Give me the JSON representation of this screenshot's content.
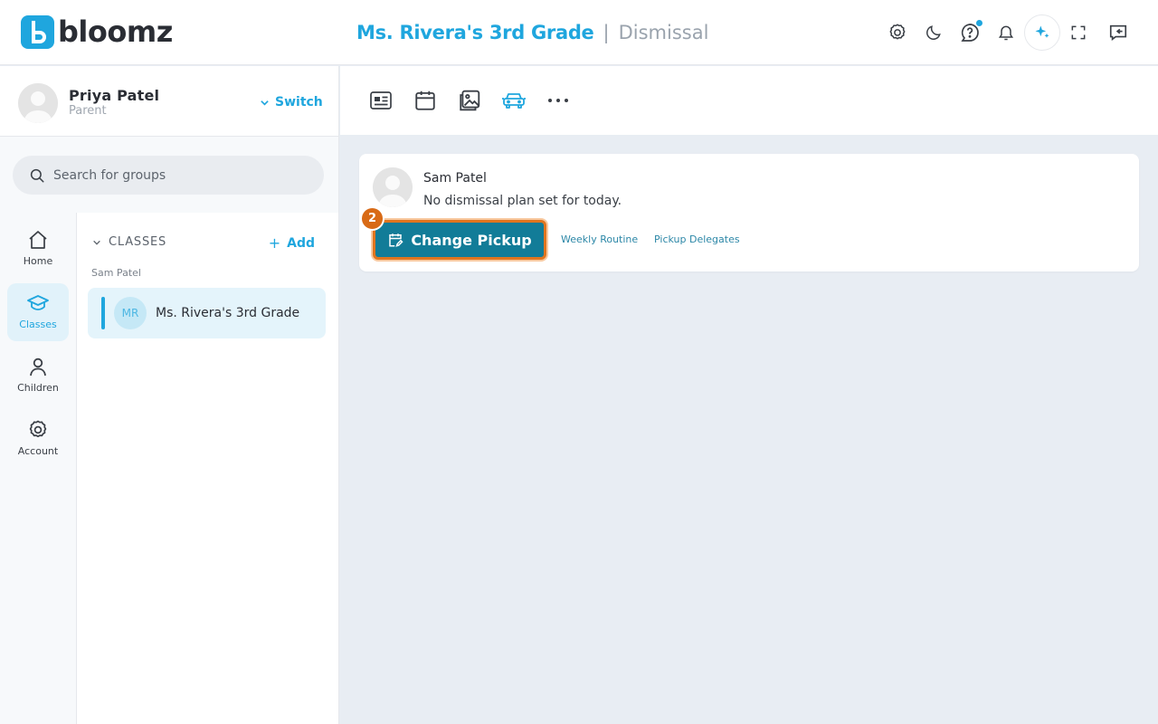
{
  "app": {
    "logo_text": "bloomz",
    "brand_color": "#1fa6de",
    "accent_color": "#127c98",
    "highlight_color": "#e0751f"
  },
  "header": {
    "group_title": "Ms. Rivera's 3rd Grade",
    "separator": "|",
    "section_title": "Dismissal",
    "icons": [
      "settings-icon",
      "moon-icon",
      "help-chat-icon",
      "bell-icon",
      "sparkle-ai-icon",
      "fullscreen-icon",
      "feedback-icon"
    ]
  },
  "profile": {
    "name": "Priya Patel",
    "role": "Parent",
    "switch_label": "Switch"
  },
  "search": {
    "placeholder": "Search for groups"
  },
  "nav": {
    "items": [
      {
        "label": "Home",
        "icon": "home-icon",
        "active": false
      },
      {
        "label": "Classes",
        "icon": "graduation-cap-icon",
        "active": true
      },
      {
        "label": "Children",
        "icon": "person-icon",
        "active": false
      },
      {
        "label": "Account",
        "icon": "gear-icon",
        "active": false
      }
    ]
  },
  "classes": {
    "header_label": "CLASSES",
    "add_label": "Add",
    "child_name": "Sam Patel",
    "items": [
      {
        "initials": "MR",
        "name": "Ms. Rivera's 3rd Grade",
        "selected": true
      }
    ]
  },
  "toolbar": {
    "icons": [
      "newsletter-icon",
      "calendar-icon",
      "photos-icon",
      "car-icon",
      "more-icon"
    ],
    "active": "car-icon"
  },
  "dismissal_card": {
    "student_name": "Sam Patel",
    "status_text": "No dismissal plan set for today.",
    "primary_button": "Change Pickup",
    "step_badge": "2",
    "links": [
      "Weekly Routine",
      "Pickup Delegates"
    ]
  }
}
